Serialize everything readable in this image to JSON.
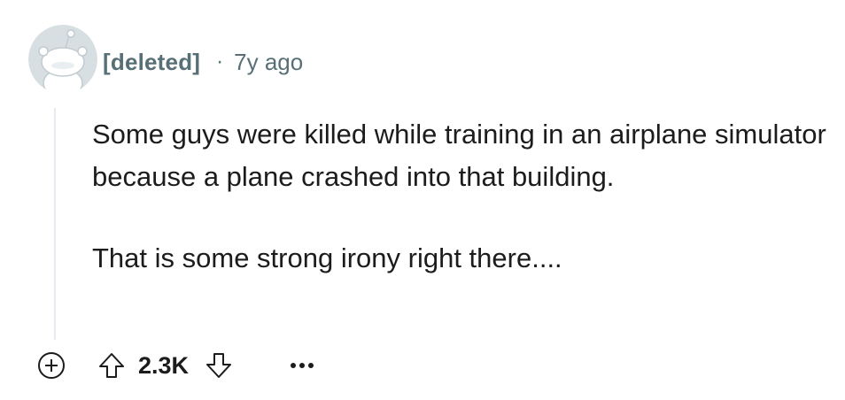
{
  "comment": {
    "author": "[deleted]",
    "separator": "·",
    "time_ago": "7y ago",
    "paragraphs": [
      "Some guys were killed while training in an airplane simulator because a plane crashed into that building.",
      "That is some strong irony right there...."
    ],
    "score": "2.3K"
  },
  "icons": {
    "avatar": "snoo-avatar-icon",
    "expand": "plus-circle-icon",
    "upvote": "arrow-up-icon",
    "downvote": "arrow-down-icon",
    "more": "more-options-icon"
  },
  "colors": {
    "text": "#1c1c1c",
    "meta": "#576f76",
    "thread_line": "#e5ebee",
    "icon": "#1c1c1c"
  }
}
